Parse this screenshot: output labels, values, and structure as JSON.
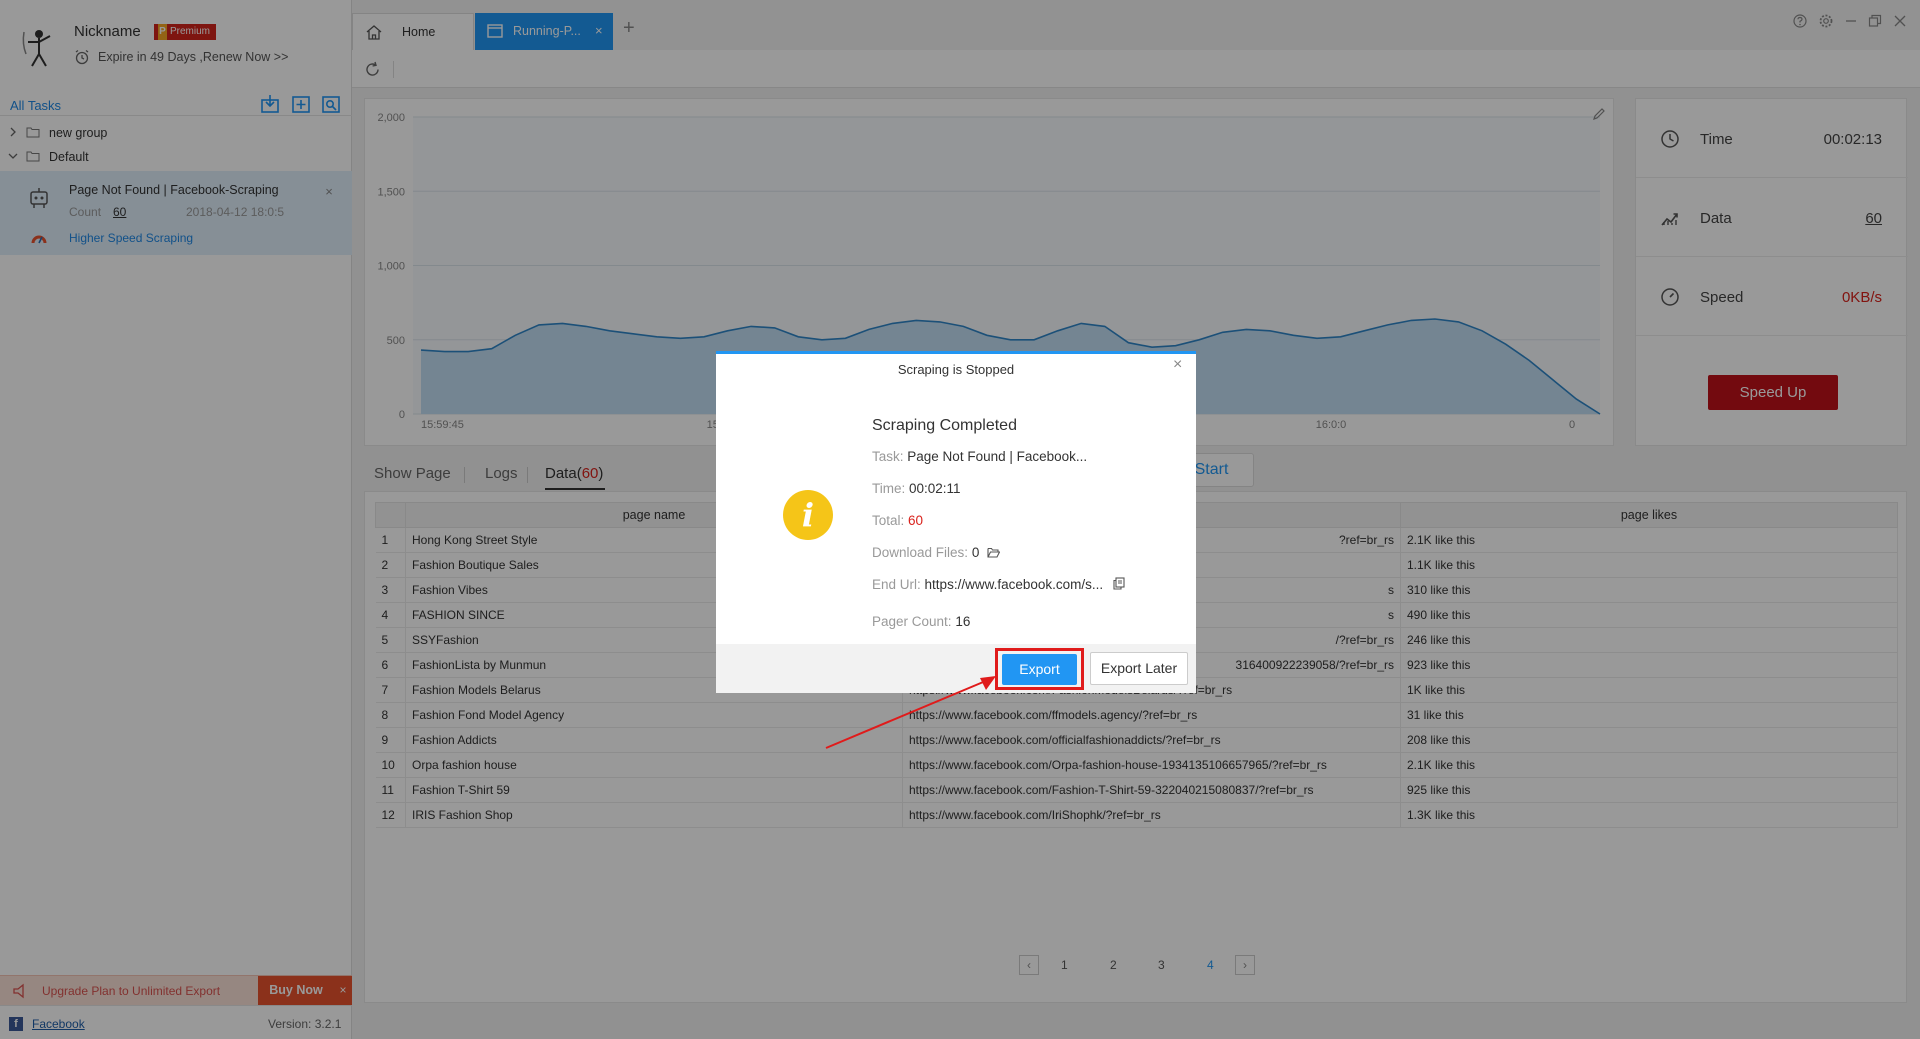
{
  "profile": {
    "nickname": "Nickname",
    "badge_letter": "P",
    "badge_label": "Premium",
    "expire_text": "Expire in 49 Days ,Renew Now >>"
  },
  "tasks": {
    "header": "All Tasks",
    "tools": [
      "import-icon",
      "add-task-icon",
      "search-task-icon"
    ],
    "groups": [
      {
        "label": "new group",
        "expanded": false
      },
      {
        "label": "Default",
        "expanded": true
      }
    ],
    "active_task": {
      "title": "Page Not Found | Facebook-Scraping",
      "count_label": "Count",
      "count": "60",
      "date": "2018-04-12 18:0:5",
      "mode": "Higher Speed Scraping"
    }
  },
  "upgrade": {
    "text": "Upgrade Plan to Unlimited Export",
    "buy_label": "Buy Now",
    "close": "×"
  },
  "footer": {
    "fb_letter": "f",
    "link_text": "Facebook",
    "version": "Version: 3.2.1"
  },
  "tabs": [
    {
      "label": "Home",
      "icon": "home-icon",
      "active": false
    },
    {
      "label": "Running-P...",
      "icon": "window-icon",
      "active": true,
      "close": "×"
    }
  ],
  "tab_add": "+",
  "chart_data": {
    "type": "area",
    "x_tick_labels": [
      "15:59:45",
      "15:59:5",
      "16:0:0",
      "0"
    ],
    "ylim": [
      0,
      2000
    ],
    "y_ticks": [
      0,
      500,
      1000,
      1500,
      2000
    ],
    "y_tick_labels": [
      "0",
      "500",
      "1,000",
      "1,500",
      "2,000"
    ],
    "grid": true,
    "color": "#2f86c9",
    "fill": "#c2def4",
    "series": [
      {
        "values": [
          430,
          420,
          420,
          440,
          530,
          600,
          610,
          590,
          560,
          540,
          520,
          510,
          520,
          560,
          590,
          580,
          520,
          500,
          510,
          570,
          610,
          630,
          620,
          590,
          530,
          500,
          500,
          560,
          610,
          590,
          480,
          450,
          460,
          500,
          550,
          570,
          560,
          530,
          510,
          520,
          560,
          600,
          630,
          640,
          620,
          560,
          470,
          360,
          230,
          100,
          0
        ]
      }
    ]
  },
  "stats": {
    "time_label": "Time",
    "time_value": "00:02:13",
    "data_label": "Data",
    "data_value": "60",
    "speed_label": "Speed",
    "speed_value": "0KB/s",
    "speed_up": "Speed Up"
  },
  "data_tabs": {
    "show_page": "Show Page",
    "logs": "Logs",
    "data": "Data",
    "data_count": "60",
    "start": "Start"
  },
  "table": {
    "columns": [
      "",
      "page name",
      "",
      "page likes"
    ],
    "rows": [
      [
        "1",
        "Hong Kong Street Style",
        "",
        "2.1K like this"
      ],
      [
        "2",
        "Fashion Boutique Sales",
        "",
        "1.1K like this"
      ],
      [
        "3",
        "Fashion Vibes",
        "",
        "310 like this"
      ],
      [
        "4",
        "FASHION SINCE",
        "",
        "490 like this"
      ],
      [
        "5",
        "SSYFashion",
        "",
        "246 like this"
      ],
      [
        "6",
        "FashionLista by Munmun",
        "",
        "923 like this"
      ],
      [
        "7",
        "Fashion Models Belarus",
        "https://www.facebook.com/FashionModelsBelarus/?ref=br_rs",
        "1K like this"
      ],
      [
        "8",
        "Fashion Fond Model Agency",
        "https://www.facebook.com/ffmodels.agency/?ref=br_rs",
        "31 like this"
      ],
      [
        "9",
        "Fashion Addicts",
        "https://www.facebook.com/officialfashionaddicts/?ref=br_rs",
        "208 like this"
      ],
      [
        "10",
        "Orpa fashion house",
        "https://www.facebook.com/Orpa-fashion-house-1934135106657965/?ref=br_rs",
        "2.1K like this"
      ],
      [
        "11",
        "Fashion T-Shirt 59",
        "https://www.facebook.com/Fashion-T-Shirt-59-322040215080837/?ref=br_rs",
        "925 like this"
      ],
      [
        "12",
        "IRIS Fashion Shop",
        "https://www.facebook.com/IriShophk/?ref=br_rs",
        "1.3K like this"
      ]
    ],
    "url_fragments": {
      "1": "?ref=br_rs",
      "3": "s",
      "4": "s",
      "5": "/?ref=br_rs",
      "6": "316400922239058/?ref=br_rs"
    }
  },
  "pagination": {
    "prev": "‹",
    "next": "›",
    "pages": [
      "1",
      "2",
      "3",
      "4"
    ],
    "current": "4"
  },
  "dialog": {
    "title": "Scraping is Stopped",
    "close": "×",
    "icon": "i",
    "heading": "Scraping Completed",
    "task_label": "Task:",
    "task_value": "Page Not Found | Facebook...",
    "time_label": "Time:",
    "time_value": "00:02:11",
    "total_label": "Total:",
    "total_value": "60",
    "files_label": "Download Files:",
    "files_value": "0",
    "url_label": "End Url:",
    "url_value": "https://www.facebook.com/s...",
    "pager_label": "Pager Count:",
    "pager_value": "16",
    "export": "Export",
    "export_later": "Export Later"
  },
  "colors": {
    "accent": "#2196f3",
    "highlight": "#e01b1b",
    "speed_up": "#c0121a",
    "total_red": "#d9221c"
  }
}
